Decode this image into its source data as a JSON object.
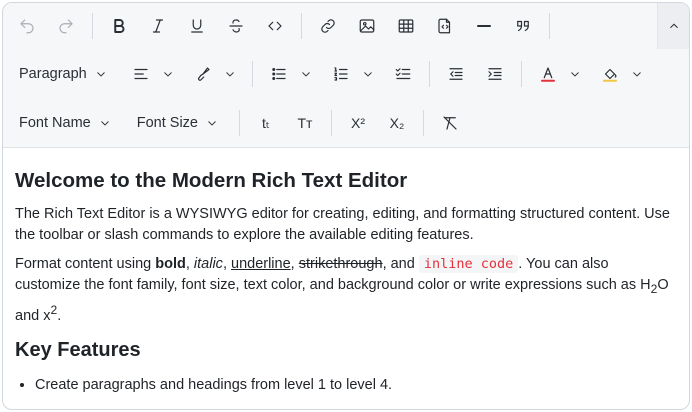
{
  "toolbar": {
    "block_format": "Paragraph",
    "font_name": "Font Name",
    "font_size": "Font Size",
    "lowercase_glyph": "tₜ",
    "uppercase_glyph": "Tт",
    "superscript_glyph": "X²",
    "subscript_glyph": "X₂",
    "font_color": "#e5303b",
    "bg_color": "#f2c744"
  },
  "doc": {
    "title": "Welcome to the Modern Rich Text Editor",
    "p1": "The Rich Text Editor is a WYSIWYG editor for creating, editing, and formatting structured content. Use the toolbar or slash commands to explore the available editing features.",
    "p2": {
      "lead": "Format content using ",
      "bold": "bold",
      "comma1": ", ",
      "italic": "italic",
      "comma2": ", ",
      "underline": "underline",
      "comma3": ", ",
      "strike": "strikethrough",
      "and": ", and ",
      "code": "inline code",
      "rest": ". You can also customize the font family, font size, text color, and background color or write expressions such as ",
      "h": "H",
      "sub": "2",
      "o_and": "O and x",
      "sup": "2",
      "end": "."
    },
    "h_features": "Key Features",
    "features": [
      "Create paragraphs and headings from level 1 to level 4."
    ]
  }
}
